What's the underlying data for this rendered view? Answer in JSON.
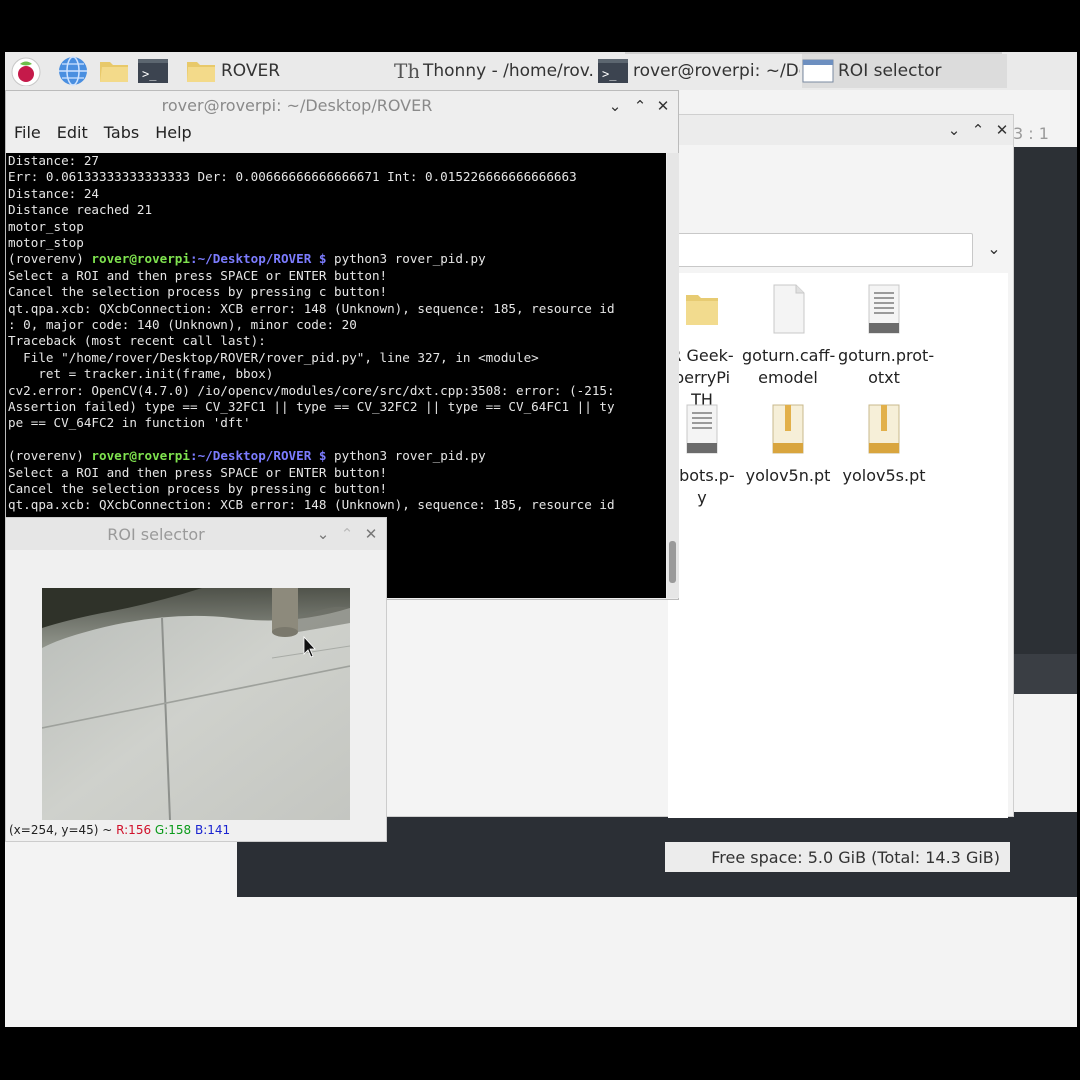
{
  "taskbar": {
    "launcher_icons": [
      "raspberry-pi-icon",
      "web-browser-icon",
      "file-manager-icon",
      "terminal-icon"
    ],
    "tasks": [
      {
        "label": "ROVER",
        "icon": "folder-icon"
      },
      {
        "label": "Thonny  -  /home/rov...",
        "icon": "thonny-icon"
      },
      {
        "label": "rover@roverpi: ~/Des...",
        "icon": "terminal-icon"
      },
      {
        "label": "ROI selector",
        "icon": "window-icon"
      }
    ]
  },
  "background": {
    "dim_text": "3 : 1"
  },
  "file_manager": {
    "files": [
      {
        "name": "R Geek-\nberryPi\nTH",
        "icon": "folder-icon"
      },
      {
        "name": "goturn.caff-\nemodel",
        "icon": "file-icon"
      },
      {
        "name": "goturn.prot-\notxt",
        "icon": "text-file-icon"
      },
      {
        "name": "obots.p-\ny",
        "icon": "python-file-icon"
      },
      {
        "name": "yolov5n.pt",
        "icon": "archive-icon"
      },
      {
        "name": "yolov5s.pt",
        "icon": "archive-icon"
      }
    ],
    "status": "Free space: 5.0 GiB (Total: 14.3 GiB)"
  },
  "terminal": {
    "title": "rover@roverpi: ~/Desktop/ROVER",
    "menu": [
      "File",
      "Edit",
      "Tabs",
      "Help"
    ],
    "lines": [
      {
        "t": "Distance: 27"
      },
      {
        "t": "Err: 0.06133333333333333 Der: 0.00666666666666671 Int: 0.015226666666666663"
      },
      {
        "t": "Distance: 24"
      },
      {
        "t": "Distance reached 21"
      },
      {
        "t": "motor_stop"
      },
      {
        "t": "motor_stop"
      },
      {
        "env": "(roverenv) ",
        "user": "rover@roverpi",
        "path": ":~/Desktop/ROVER $",
        "cmd": " python3 rover_pid.py"
      },
      {
        "t": "Select a ROI and then press SPACE or ENTER button!"
      },
      {
        "t": "Cancel the selection process by pressing c button!"
      },
      {
        "t": "qt.qpa.xcb: QXcbConnection: XCB error: 148 (Unknown), sequence: 185, resource id"
      },
      {
        "t": ": 0, major code: 140 (Unknown), minor code: 20"
      },
      {
        "t": "Traceback (most recent call last):"
      },
      {
        "t": "  File \"/home/rover/Desktop/ROVER/rover_pid.py\", line 327, in <module>"
      },
      {
        "t": "    ret = tracker.init(frame, bbox)"
      },
      {
        "t": "cv2.error: OpenCV(4.7.0) /io/opencv/modules/core/src/dxt.cpp:3508: error: (-215:"
      },
      {
        "t": "Assertion failed) type == CV_32FC1 || type == CV_32FC2 || type == CV_64FC1 || ty"
      },
      {
        "t": "pe == CV_64FC2 in function 'dft'"
      },
      {
        "t": ""
      },
      {
        "env": "(roverenv) ",
        "user": "rover@roverpi",
        "path": ":~/Desktop/ROVER $",
        "cmd": " python3 rover_pid.py"
      },
      {
        "t": "Select a ROI and then press SPACE or ENTER button!"
      },
      {
        "t": "Cancel the selection process by pressing c button!"
      },
      {
        "t": "qt.qpa.xcb: QXcbConnection: XCB error: 148 (Unknown), sequence: 185, resource id"
      }
    ]
  },
  "roi_window": {
    "title": "ROI selector",
    "status_prefix": "(x=254, y=45) ~ ",
    "r": "R:156",
    "g": "G:158",
    "b": "B:141"
  }
}
